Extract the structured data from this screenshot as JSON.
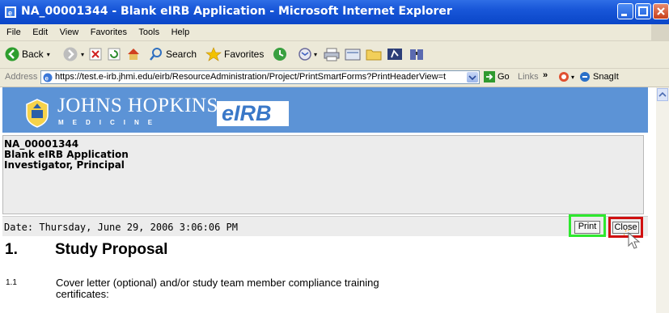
{
  "window": {
    "title": "NA_00001344 - Blank eIRB Application - Microsoft Internet Explorer"
  },
  "menu": {
    "items": [
      "File",
      "Edit",
      "View",
      "Favorites",
      "Tools",
      "Help"
    ]
  },
  "toolbar": {
    "back_label": "Back",
    "search_label": "Search",
    "favorites_label": "Favorites"
  },
  "address": {
    "label": "Address",
    "url": "https://test.e-irb.jhmi.edu/eirb/ResourceAdministration/Project/PrintSmartForms?PrintHeaderView=t",
    "go_label": "Go",
    "links_label": "Links",
    "chevron": "»",
    "snagit_label": "SnagIt"
  },
  "banner": {
    "brand": "JOHNS HOPKINS",
    "sub": "MEDICINE",
    "product": "eIRB"
  },
  "info": {
    "id": "NA_00001344",
    "name": "Blank eIRB Application",
    "role": "Investigator, Principal"
  },
  "datebar": {
    "date": "Date: Thursday, June 29, 2006 3:06:06 PM",
    "print_label": "Print",
    "close_label": "Close"
  },
  "section": {
    "number": "1.",
    "title": "Study Proposal",
    "item_number": "1.1",
    "item_text": "Cover letter (optional) and/or study team member compliance training certificates:"
  },
  "colors": {
    "title_bar": "#0a46c8",
    "banner": "#5c93d6",
    "highlight_print": "#2ee82e",
    "highlight_close": "#d01010"
  }
}
